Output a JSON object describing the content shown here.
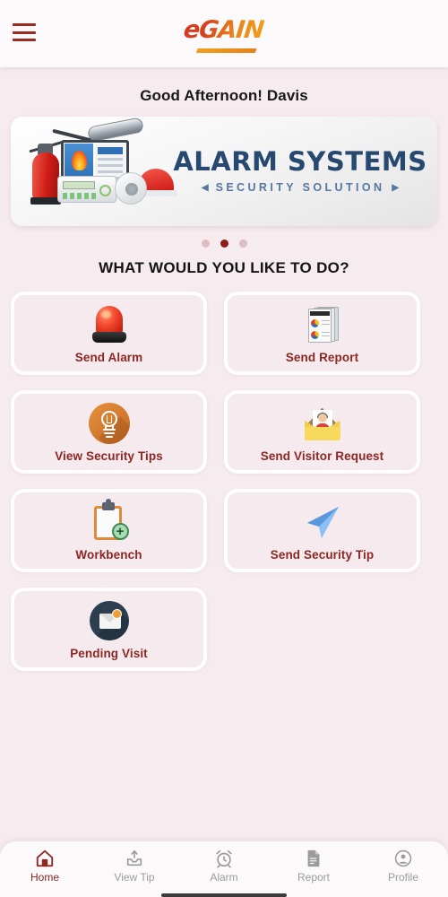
{
  "header": {
    "menu_icon": "hamburger-menu-icon",
    "logo_text": "eGAIN"
  },
  "greeting": "Good Afternoon! Davis",
  "banner": {
    "title": "ALARM SYSTEMS",
    "subtitle": "SECURITY SOLUTION",
    "arrow_left": "◀",
    "arrow_right": "▶",
    "illustration": "security-equipment-illustration"
  },
  "carousel": {
    "total_dots": 3,
    "active_index": 1
  },
  "section": {
    "title": "WHAT WOULD YOU LIKE TO DO?"
  },
  "actions": [
    {
      "label": "Send Alarm",
      "icon": "siren-icon"
    },
    {
      "label": "Send Report",
      "icon": "report-documents-icon"
    },
    {
      "label": "View Security Tips",
      "icon": "lightbulb-icon"
    },
    {
      "label": "Send Visitor Request",
      "icon": "envelope-person-icon"
    },
    {
      "label": "Workbench",
      "icon": "clipboard-plus-icon"
    },
    {
      "label": "Send Security Tip",
      "icon": "paper-plane-icon"
    },
    {
      "label": "Pending Visit",
      "icon": "envelope-notification-icon"
    }
  ],
  "bottom_nav": [
    {
      "label": "Home",
      "icon": "home-icon",
      "active": true
    },
    {
      "label": "View Tip",
      "icon": "upload-tray-icon",
      "active": false
    },
    {
      "label": "Alarm",
      "icon": "alarm-clock-icon",
      "active": false
    },
    {
      "label": "Report",
      "icon": "document-icon",
      "active": false
    },
    {
      "label": "Profile",
      "icon": "person-circle-icon",
      "active": false
    }
  ],
  "colors": {
    "background": "#f6ebef",
    "header_bg": "#fbf9f9",
    "accent_red": "#8e2723",
    "logo_red": "#d33a20",
    "logo_orange": "#f0a01c",
    "banner_navy": "#27486f",
    "card_bg": "#f5eaee",
    "card_border": "#fffdfd",
    "dot_active": "#8b1c16",
    "dot_inactive": "#ddbcc2",
    "nav_inactive": "#9b9b9b"
  }
}
